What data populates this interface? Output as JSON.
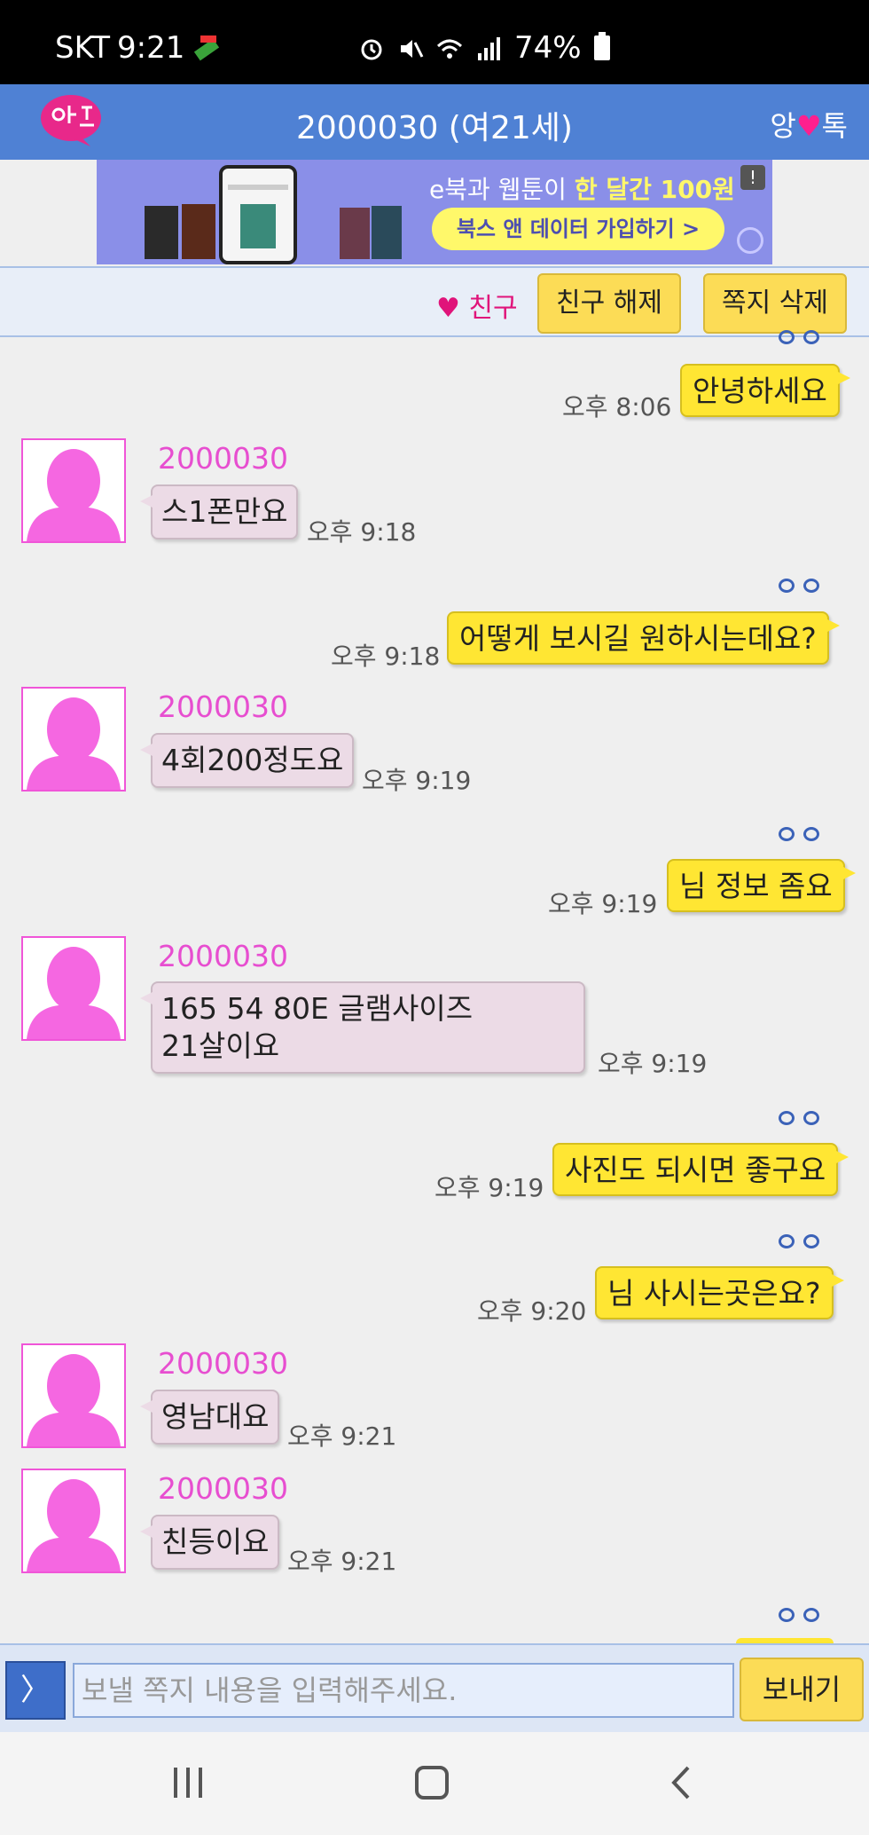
{
  "status_bar": {
    "carrier": "SKT",
    "time": "9:21",
    "battery": "74%"
  },
  "header": {
    "title": "2000030 (여21세)",
    "brand_left": "앙",
    "brand_right": "톡"
  },
  "ad": {
    "line1_prefix": "e북과 웹툰이 ",
    "line1_highlight": "한 달간 100원",
    "button": "북스 앤 데이터 가입하기 >",
    "info": "!"
  },
  "action_bar": {
    "friend_label": "♥ 친구",
    "unfriend_button": "친구 해제",
    "delete_button": "쪽지 삭제"
  },
  "messages": [
    {
      "dir": "out",
      "text": "안녕하세요",
      "time": "오후 8:06"
    },
    {
      "dir": "in",
      "sender": "2000030",
      "text": "스1폰만요",
      "time": "오후 9:18"
    },
    {
      "dir": "out",
      "text": "어떻게 보시길 원하시는데요?",
      "time": "오후 9:18"
    },
    {
      "dir": "in",
      "sender": "2000030",
      "text": "4회200정도요",
      "time": "오후 9:19"
    },
    {
      "dir": "out",
      "text": "님 정보 좀요",
      "time": "오후 9:19"
    },
    {
      "dir": "in",
      "sender": "2000030",
      "text_line1": "165 54 80E 글램사이즈",
      "text_line2": "21살이요",
      "time": "오후 9:19"
    },
    {
      "dir": "out",
      "text": "사진도 되시면 좋구요",
      "time": "오후 9:19"
    },
    {
      "dir": "out",
      "text": "님 사시는곳은요?",
      "time": "오후 9:20"
    },
    {
      "dir": "in",
      "sender": "2000030",
      "text": "영남대요",
      "time": "오후 9:21"
    },
    {
      "dir": "in",
      "sender": "2000030",
      "text": "친등이요",
      "time": "오후 9:21"
    }
  ],
  "input_bar": {
    "arrow": "〉",
    "placeholder": "보낼 쪽지 내용을 입력해주세요.",
    "send_button": "보내기"
  },
  "colors": {
    "header": "#4f81d4",
    "outgoing_bubble": "#ffe633",
    "incoming_bubble": "#ecdbe6",
    "button_yellow": "#fcdc56",
    "sender_name": "#e74ed0"
  },
  "icons": [
    "fake-gps-icon",
    "alarm-icon",
    "mute-icon",
    "wifi-icon",
    "signal-icon",
    "battery-icon",
    "ad-info-icon",
    "eyes-icon",
    "avatar-icon",
    "recent-apps-icon",
    "home-icon",
    "back-icon"
  ]
}
